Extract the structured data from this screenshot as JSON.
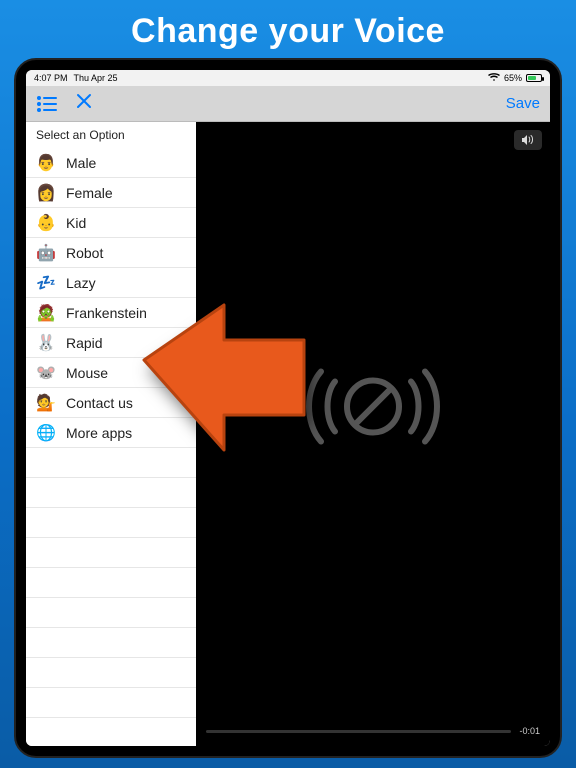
{
  "promo": {
    "title": "Change your Voice"
  },
  "statusbar": {
    "time": "4:07 PM",
    "date": "Thu Apr 25",
    "battery": "65%"
  },
  "toolbar": {
    "save_label": "Save"
  },
  "sidebar": {
    "header": "Select an Option",
    "items": [
      {
        "label": "Male",
        "emoji": "👨"
      },
      {
        "label": "Female",
        "emoji": "👩"
      },
      {
        "label": "Kid",
        "emoji": "👶"
      },
      {
        "label": "Robot",
        "emoji": "🤖"
      },
      {
        "label": "Lazy",
        "emoji": "💤"
      },
      {
        "label": "Frankenstein",
        "emoji": "🧟"
      },
      {
        "label": "Rapid",
        "emoji": "🐰"
      },
      {
        "label": "Mouse",
        "emoji": "🐭"
      },
      {
        "label": "Contact us",
        "emoji": "💁"
      },
      {
        "label": "More apps",
        "emoji": "🌐"
      }
    ]
  },
  "player": {
    "remaining": "-0:01"
  }
}
